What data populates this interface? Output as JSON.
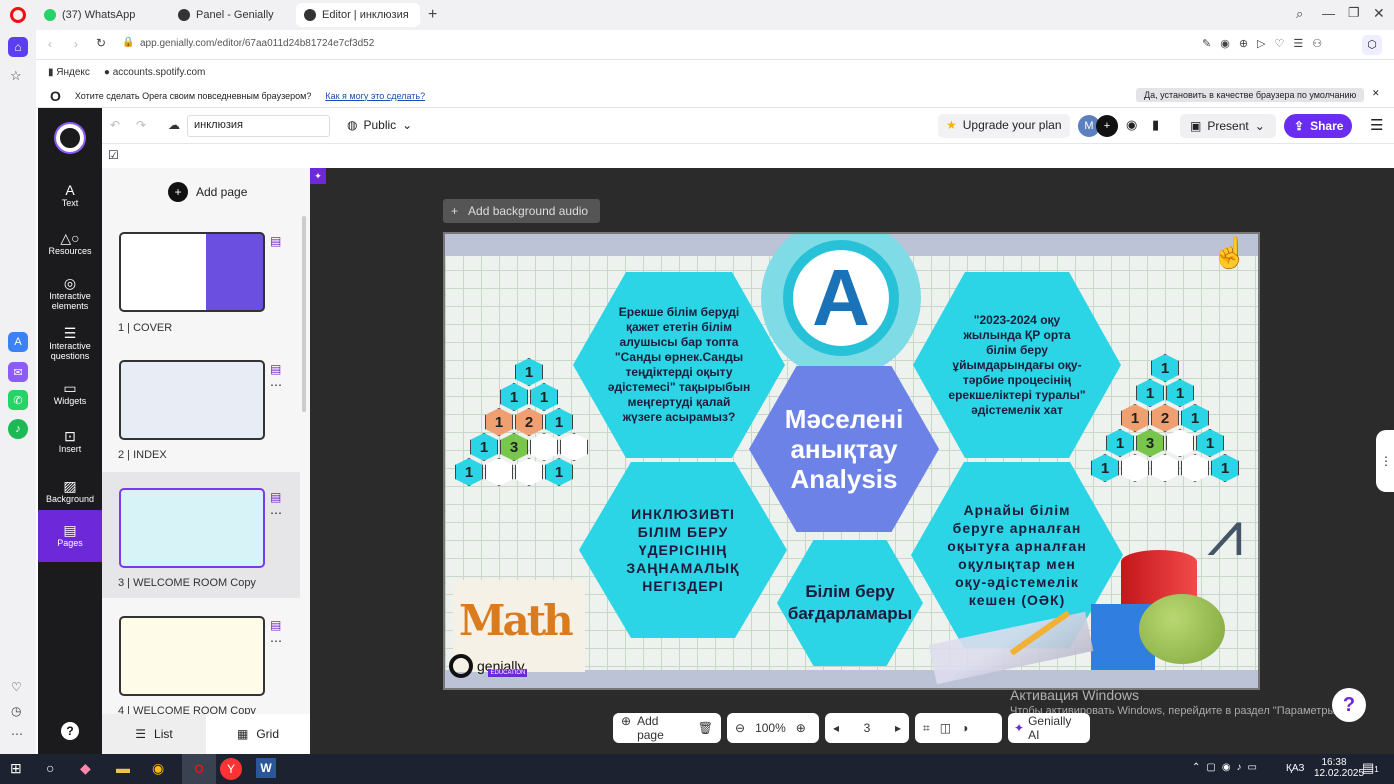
{
  "tabs": [
    {
      "label": "(37) WhatsApp",
      "color": "#25d366"
    },
    {
      "label": "Panel - Genially",
      "color": "#333"
    },
    {
      "label": "Editor | инклюзия",
      "color": "#333"
    }
  ],
  "address": {
    "url": "app.genially.com/editor/67aa011d24b81724e7cf3d52"
  },
  "bookmarks": [
    "Яндекс",
    "accounts.spotify.com"
  ],
  "promo": {
    "text": "Хотите сделать Opera своим повседневным браузером?",
    "link": "Как я могу это сделать?",
    "button": "Да, установить в качестве браузера по умолчанию"
  },
  "toolbar": {
    "project_name": "инклюзия",
    "visibility": "Public",
    "upgrade": "Upgrade your plan",
    "avatar": "M",
    "present": "Present",
    "share": "Share"
  },
  "sidebar": {
    "items": [
      {
        "label": "Text",
        "icon": "text-icon"
      },
      {
        "label": "Resources",
        "icon": "resources-icon"
      },
      {
        "label": "Interactive elements",
        "icon": "interactive-elements-icon"
      },
      {
        "label": "Interactive questions",
        "icon": "questions-icon"
      },
      {
        "label": "Widgets",
        "icon": "widgets-icon"
      },
      {
        "label": "Insert",
        "icon": "insert-icon"
      },
      {
        "label": "Background",
        "icon": "background-icon"
      },
      {
        "label": "Pages",
        "icon": "pages-icon"
      }
    ]
  },
  "pages_panel": {
    "add_page": "Add page",
    "pages": [
      {
        "label": "1 |  COVER"
      },
      {
        "label": "2 |  INDEX"
      },
      {
        "label": "3 |  WELCOME ROOM Copy"
      },
      {
        "label": "4 |  WELCOME ROOM Copy"
      }
    ],
    "view_list": "List",
    "view_grid": "Grid"
  },
  "canvas": {
    "add_audio": "Add background audio",
    "center_title": "Мәселені анықтау Analysis",
    "letter": "A",
    "hex_top_left": "Ерекше білім беруді қажет ететін білім алушысы бар топта \"Санды өрнек.Санды теңдіктерді оқыту әдістемесі\" тақырыбын меңгертуді қалай жүзеге асырамыз?",
    "hex_top_right": "\"2023-2024 оқу жылында ҚР орта білім беру ұйымдарындағы оқу-тәрбие процесінің ерекшеліктері туралы\" әдістемелік хат",
    "hex_bottom_left": "ИНКЛЮЗИВТІ БІЛІМ БЕРУ ҮДЕРІСІНІҢ ЗАҢНАМАЛЫҚ НЕГІЗДЕРІ",
    "hex_bottom_right": "Арнайы білім беруге арналған оқытуға арналған оқулықтар мен оқу-әдістемелік кешен (ОӘК)",
    "hex_bottom_center": "Білім беру бағдарламары",
    "brand": "genially",
    "brand_sub": "EDUCATION",
    "math_word": "Math",
    "left_triangle": [
      [
        "1"
      ],
      [
        "1",
        "1"
      ],
      [
        "1",
        "2",
        "1"
      ],
      [
        "1",
        "3",
        "",
        ""
      ],
      [
        "1",
        "",
        "",
        "1"
      ]
    ],
    "right_triangle": [
      [
        "1"
      ],
      [
        "1",
        "1"
      ],
      [
        "1",
        "2",
        "1"
      ],
      [
        "1",
        "3",
        "",
        "1"
      ],
      [
        "1",
        "",
        "",
        "",
        "1"
      ]
    ]
  },
  "bottom": {
    "add_page": "Add page",
    "zoom": "100%",
    "page": "3",
    "ai": "Genially AI"
  },
  "watermark": {
    "line1": "Активация Windows",
    "line2": "Чтобы активировать Windows, перейдите в раздел \"Параметры\"."
  },
  "taskbar": {
    "lang": "ҚАЗ",
    "time": "16:38",
    "date": "12.02.2025",
    "notif": "1"
  }
}
